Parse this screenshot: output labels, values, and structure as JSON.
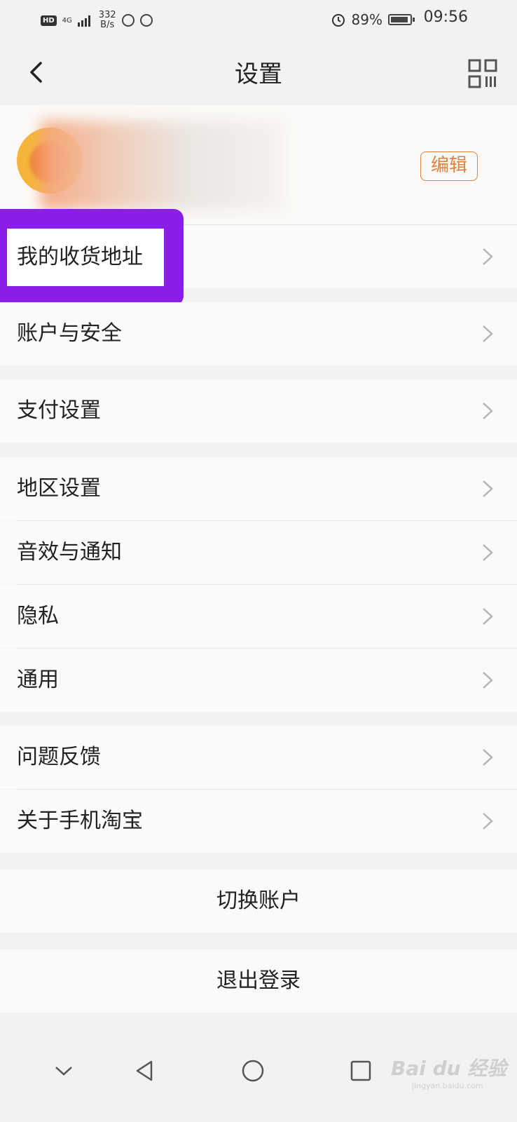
{
  "status": {
    "hd": "HD",
    "network": "4G",
    "speed_value": "332",
    "speed_unit": "B/s",
    "battery": "89%",
    "time": "09:56"
  },
  "header": {
    "title": "设置"
  },
  "profile": {
    "edit_label": "编辑"
  },
  "menu": {
    "address": "我的收货地址",
    "account_security": "账户与安全",
    "payment": "支付设置",
    "region": "地区设置",
    "sound": "音效与通知",
    "privacy": "隐私",
    "general": "通用",
    "feedback": "问题反馈",
    "about": "关于手机淘宝",
    "switch_account": "切换账户",
    "logout": "退出登录"
  },
  "watermark": {
    "brand": "Bai du 经验",
    "url": "jingyan.baidu.com"
  },
  "colors": {
    "accent": "#e0813e",
    "highlight": "#8a1ee6"
  }
}
